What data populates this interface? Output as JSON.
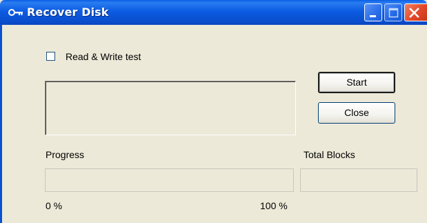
{
  "window": {
    "title": "Recover Disk",
    "icon": "key-icon",
    "controls": [
      "minimize-icon",
      "maximize-icon",
      "close-icon"
    ]
  },
  "options": {
    "read_write_test": {
      "label": "Read & Write test",
      "checked": false
    }
  },
  "buttons": {
    "start_label": "Start",
    "close_label": "Close"
  },
  "progress": {
    "label": "Progress",
    "value": 0,
    "min_label": "0 %",
    "max_label": "100 %"
  },
  "total_blocks": {
    "label": "Total Blocks",
    "value": ""
  },
  "colors": {
    "titlebar": "#0a5ee6",
    "window_bg": "#ece9d8",
    "close_button": "#e2482a",
    "progress_fill": "#3c9b3c"
  }
}
